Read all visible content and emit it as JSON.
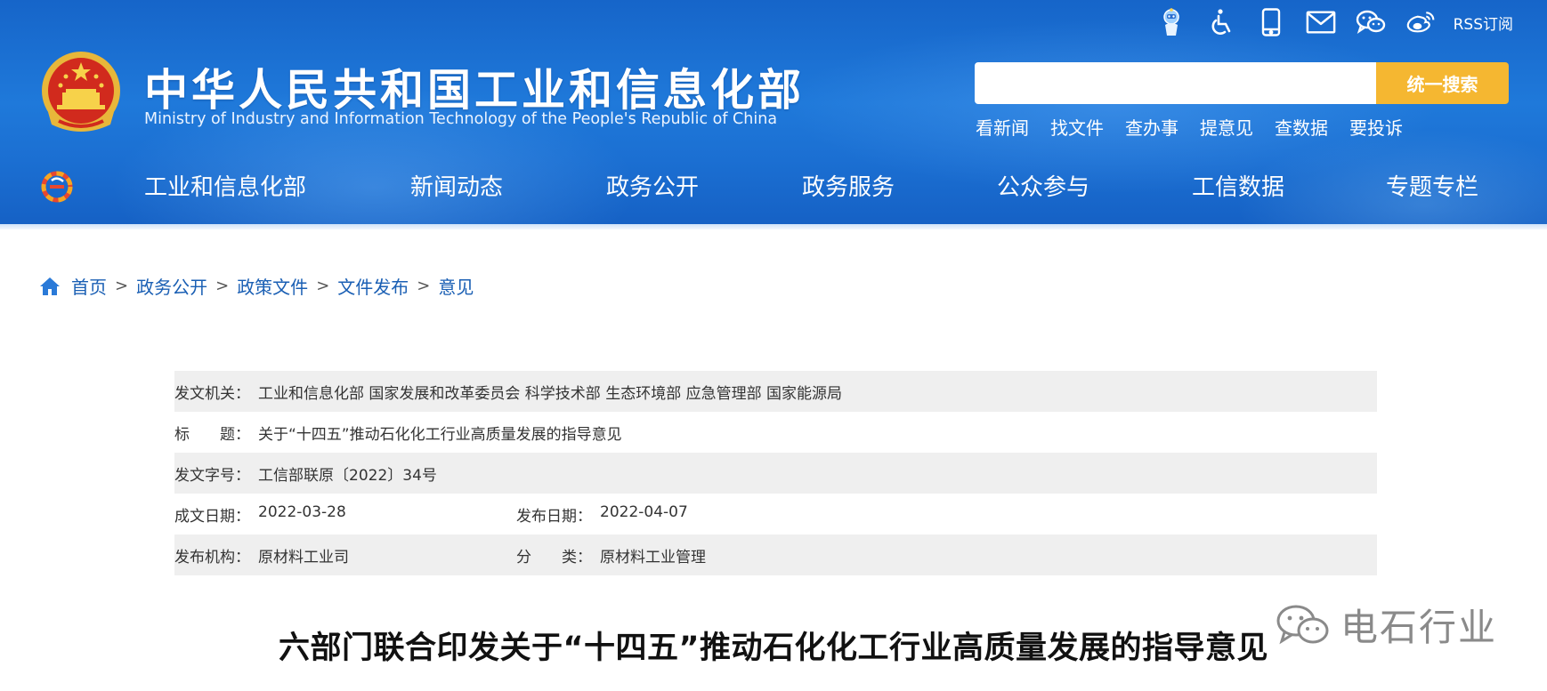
{
  "header": {
    "title_cn": "中华人民共和国工业和信息化部",
    "title_en": "Ministry of Industry and Information Technology of the People's Republic of China",
    "top_icons": [
      "robot-assistant-icon",
      "accessibility-icon",
      "mobile-icon",
      "mail-icon",
      "wechat-icon",
      "weibo-icon"
    ],
    "rss_label": "RSS订阅",
    "search": {
      "placeholder": "",
      "button": "统一搜索"
    },
    "quick_links": [
      "看新闻",
      "找文件",
      "查办事",
      "提意见",
      "查数据",
      "要投诉"
    ],
    "nav": [
      "工业和信息化部",
      "新闻动态",
      "政务公开",
      "政务服务",
      "公众参与",
      "工信数据",
      "专题专栏"
    ],
    "colors": {
      "header_blue": "#1b6fd2",
      "search_button": "#f5b731"
    }
  },
  "breadcrumb": [
    "首页",
    "政务公开",
    "政策文件",
    "文件发布",
    "意见"
  ],
  "breadcrumb_sep": ">",
  "meta": {
    "issuer_label": "发文机关：",
    "issuer": "工业和信息化部 国家发展和改革委员会 科学技术部 生态环境部 应急管理部 国家能源局",
    "title_label": "标　　题：",
    "title": "关于“十四五”推动石化化工行业高质量发展的指导意见",
    "doc_no_label": "发文字号：",
    "doc_no": "工信部联原〔2022〕34号",
    "written_date_label": "成文日期：",
    "written_date": "2022-03-28",
    "publish_date_label": "发布日期：",
    "publish_date": "2022-04-07",
    "publisher_label": "发布机构：",
    "publisher": "原材料工业司",
    "category_label": "分　　类：",
    "category": "原材料工业管理"
  },
  "article_title": "六部门联合印发关于“十四五”推动石化化工行业高质量发展的指导意见",
  "watermark": "电石行业"
}
